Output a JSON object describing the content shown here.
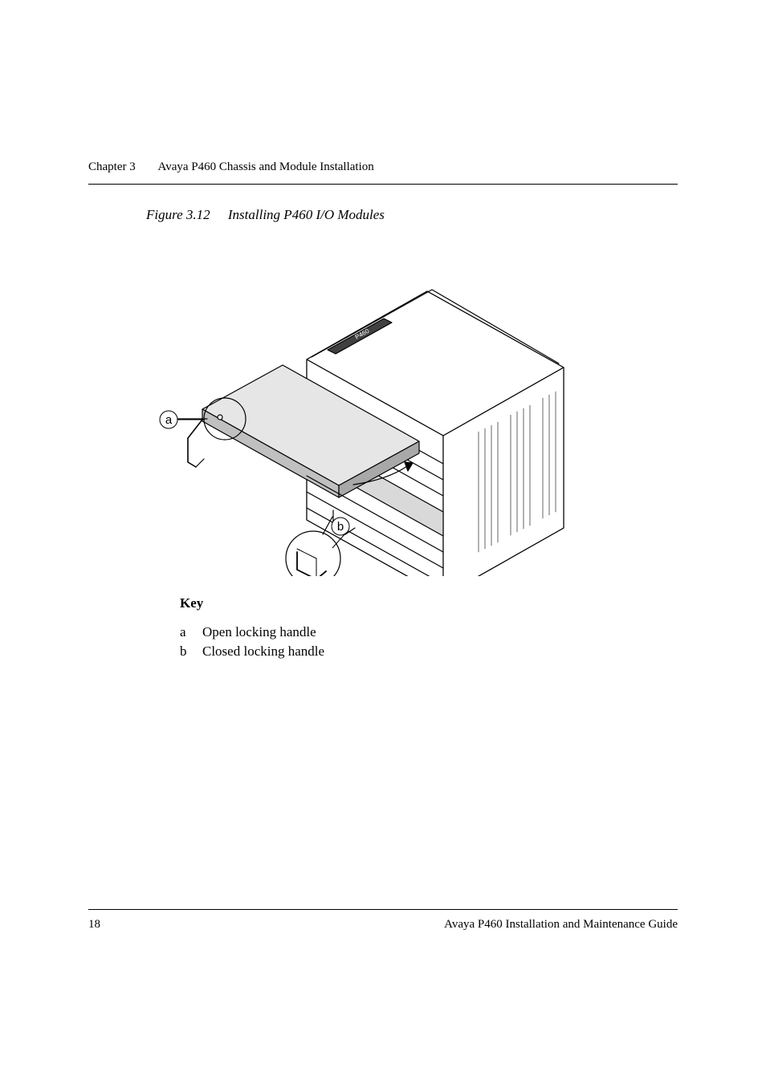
{
  "header": {
    "chapter_label": "Chapter 3",
    "chapter_title": "Avaya P460 Chassis and Module Installation"
  },
  "figure": {
    "number": "Figure 3.12",
    "title": "Installing P460 I/O Modules",
    "callout_a": "a",
    "callout_b": "b",
    "chassis_label": "P460"
  },
  "key": {
    "heading": "Key",
    "items": [
      {
        "letter": "a",
        "text": "Open locking handle"
      },
      {
        "letter": "b",
        "text": "Closed locking handle"
      }
    ]
  },
  "footer": {
    "page_number": "18",
    "doc_title": "Avaya P460 Installation and Maintenance Guide"
  }
}
